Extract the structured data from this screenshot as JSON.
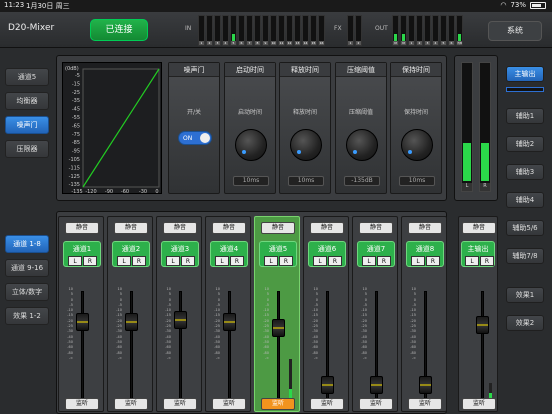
{
  "status": {
    "time": "11:23",
    "date": "1月30日 周三",
    "battery": "73%"
  },
  "header": {
    "title": "D20-Mixer",
    "connect_label": "已连接",
    "system_label": "系统",
    "in_label": "IN",
    "fx_label": "FX",
    "out_label": "OUT",
    "in_meters": [
      {
        "num": "1",
        "level": 0
      },
      {
        "num": "2",
        "level": 0
      },
      {
        "num": "3",
        "level": 0
      },
      {
        "num": "4",
        "level": 0
      },
      {
        "num": "5",
        "level": 0.25
      },
      {
        "num": "6",
        "level": 0
      },
      {
        "num": "7",
        "level": 0
      },
      {
        "num": "8",
        "level": 0
      },
      {
        "num": "9",
        "level": 0
      },
      {
        "num": "10",
        "level": 0
      },
      {
        "num": "11",
        "level": 0
      },
      {
        "num": "12",
        "level": 0
      },
      {
        "num": "13",
        "level": 0
      },
      {
        "num": "14",
        "level": 0
      },
      {
        "num": "15",
        "level": 0
      },
      {
        "num": "16",
        "level": 0
      }
    ],
    "fx_meters": [
      {
        "num": "1",
        "level": 0
      },
      {
        "num": "2",
        "level": 0
      }
    ],
    "out_meters": [
      {
        "num": "M",
        "level": 0.25
      },
      {
        "num": "M",
        "level": 0.25
      },
      {
        "num": "1",
        "level": 0
      },
      {
        "num": "2",
        "level": 0
      },
      {
        "num": "3",
        "level": 0
      },
      {
        "num": "4",
        "level": 0
      },
      {
        "num": "5",
        "level": 0
      },
      {
        "num": "6",
        "level": 0
      },
      {
        "num": "7/8",
        "level": 0.25
      }
    ]
  },
  "left_nav": {
    "top_items": [
      {
        "label": "通道5",
        "active": false
      },
      {
        "label": "均衡器",
        "active": false
      },
      {
        "label": "噪声门",
        "active": true
      },
      {
        "label": "压限器",
        "active": false
      }
    ],
    "bottom_items": [
      {
        "label": "通道 1-8",
        "active": true
      },
      {
        "label": "通道 9-16",
        "active": false
      },
      {
        "label": "立体/数字",
        "active": false
      },
      {
        "label": "效果 1-2",
        "active": false
      }
    ]
  },
  "gate": {
    "graph": {
      "unit": "(0dB)",
      "y_ticks": [
        "-5",
        "-15",
        "-25",
        "-35",
        "-45",
        "-55",
        "-65",
        "-75",
        "-85",
        "-95",
        "-105",
        "-115",
        "-125",
        "-135"
      ],
      "x_ticks": [
        "-135",
        "-120",
        "-90",
        "-60",
        "-30",
        "0"
      ]
    },
    "columns": [
      {
        "header": "噪声门",
        "sub": "开/关",
        "toggle": "ON"
      },
      {
        "header": "启动时间",
        "sub": "启动时间",
        "value": "10ms"
      },
      {
        "header": "释放时间",
        "sub": "释放时间",
        "value": "10ms"
      },
      {
        "header": "压缩阈值",
        "sub": "压缩阈值",
        "value": "-135dB"
      },
      {
        "header": "保持时间",
        "sub": "保持时间",
        "value": "10ms"
      }
    ],
    "meter_labels": [
      "L",
      "R"
    ]
  },
  "bus": {
    "items": [
      {
        "label": "主输出",
        "active": true
      },
      {
        "label": "辅助1",
        "active": false
      },
      {
        "label": "辅助2",
        "active": false
      },
      {
        "label": "辅助3",
        "active": false
      },
      {
        "label": "辅助4",
        "active": false
      },
      {
        "label": "辅助5/6",
        "active": false
      },
      {
        "label": "辅助7/8",
        "active": false
      },
      {
        "label": "效果1",
        "active": false
      },
      {
        "label": "效果2",
        "active": false
      }
    ]
  },
  "strips": {
    "mute_label": "静音",
    "monitor_label": "监听",
    "l_label": "L",
    "r_label": "R",
    "scale": [
      "10",
      "5",
      "0",
      "-5",
      "-10",
      "-15",
      "-20",
      "-25",
      "-30",
      "-40",
      "-50",
      "-60",
      "-80",
      "-∞"
    ],
    "channels": [
      {
        "name": "通道1",
        "fader": 0.78,
        "selected": false,
        "monitor_on": false,
        "level": 0
      },
      {
        "name": "通道2",
        "fader": 0.78,
        "selected": false,
        "monitor_on": false,
        "level": 0
      },
      {
        "name": "通道3",
        "fader": 0.8,
        "selected": false,
        "monitor_on": false,
        "level": 0
      },
      {
        "name": "通道4",
        "fader": 0.78,
        "selected": false,
        "monitor_on": false,
        "level": 0
      },
      {
        "name": "通道5",
        "fader": 0.72,
        "selected": true,
        "monitor_on": true,
        "level": 0.25
      },
      {
        "name": "通道6",
        "fader": 0.15,
        "selected": false,
        "monitor_on": false,
        "level": 0
      },
      {
        "name": "通道7",
        "fader": 0.15,
        "selected": false,
        "monitor_on": false,
        "level": 0
      },
      {
        "name": "通道8",
        "fader": 0.15,
        "selected": false,
        "monitor_on": false,
        "level": 0
      }
    ],
    "main": {
      "name": "主输出",
      "fader": 0.75,
      "monitor_label": "监听"
    }
  }
}
